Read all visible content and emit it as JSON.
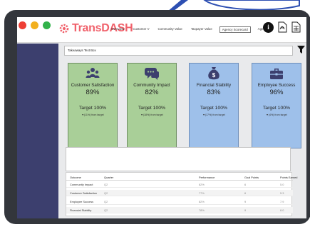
{
  "header": {
    "brand": "Trans",
    "brand_suffix": "DASH",
    "nav": [
      "Overview",
      "Customer V",
      "Community Value",
      "Taxpayer Value",
      "Agency Scorecard",
      "Agency"
    ],
    "info_label": "i"
  },
  "textbox": {
    "value": "Takeaways Text Box"
  },
  "cards": [
    {
      "label": "Customer Satisfaction",
      "value": "89%",
      "target": "Target 100%",
      "note": "▼(11%) from target",
      "icon": "people-group-icon",
      "color": "#a9cf98"
    },
    {
      "label": "Community Impact",
      "value": "82%",
      "target": "Target 100%",
      "note": "▼(18%) from target",
      "icon": "chat-bubbles-icon",
      "color": "#a9cf98"
    },
    {
      "label": "Financial Stability",
      "value": "83%",
      "target": "Target 100%",
      "note": "▼(17%) from target",
      "icon": "money-bag-icon",
      "color": "#9ec0ea"
    },
    {
      "label": "Employee Success",
      "value": "96%",
      "target": "Target 100%",
      "note": "▼(4%) from target",
      "icon": "briefcase-icon",
      "color": "#9ec0ea"
    }
  ],
  "table": {
    "headers": [
      "Outcome",
      "Quarter",
      "Performance",
      "Goal Points",
      "Points Earned"
    ],
    "rows": [
      [
        "Community Impact",
        "Q2",
        "82%",
        "6",
        "5.0"
      ],
      [
        "Customer Satisfaction",
        "Q2",
        "77%",
        "6",
        "5.3"
      ],
      [
        "Employee Success",
        "Q2",
        "82%",
        "9",
        "7.9"
      ],
      [
        "Financial Stability",
        "Q2",
        "78%",
        "9",
        "8.0"
      ]
    ]
  },
  "colors": {
    "brand": "#f0616b",
    "sidebar": "#3c3f6e",
    "green_card": "#a9cf98",
    "blue_card": "#9ec0ea"
  }
}
